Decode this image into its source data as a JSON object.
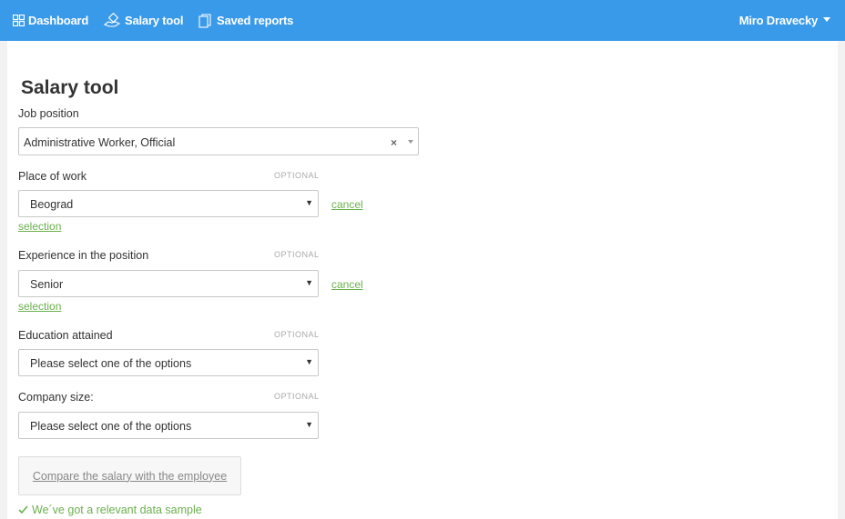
{
  "nav": {
    "dashboard": "Dashboard",
    "salary_tool": "Salary tool",
    "saved_reports": "Saved reports",
    "user_name": "Miro Dravecky"
  },
  "page": {
    "title": "Salary tool"
  },
  "form": {
    "job_position": {
      "label": "Job position",
      "value": "Administrative Worker, Official",
      "clear_glyph": "×"
    },
    "place_of_work": {
      "label": "Place of work",
      "optional": "OPTIONAL",
      "value": "Beograd",
      "cancel_part1": "cancel",
      "cancel_part2": "selection"
    },
    "experience": {
      "label": "Experience in the position",
      "optional": "OPTIONAL",
      "value": "Senior",
      "cancel_part1": "cancel",
      "cancel_part2": "selection"
    },
    "education": {
      "label": "Education attained",
      "optional": "OPTIONAL",
      "value": "Please select one of the options"
    },
    "company_size": {
      "label": "Company size:",
      "optional": "OPTIONAL",
      "value": "Please select one of the options"
    },
    "arrow_glyph": "▼"
  },
  "compare_button": "Compare the salary with the employee",
  "status_message": "We´ve got a relevant data sample",
  "colors": {
    "topbar": "#3a9aea",
    "accent_green": "#6ab04c"
  }
}
